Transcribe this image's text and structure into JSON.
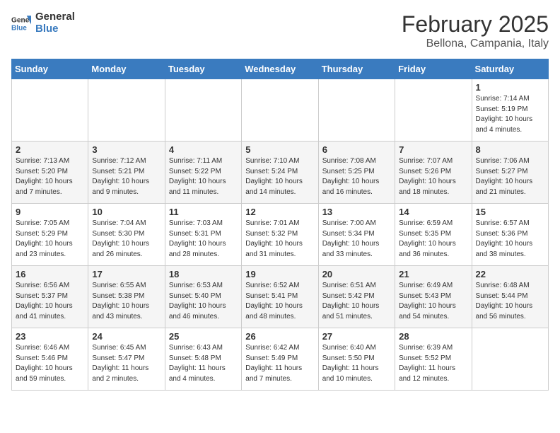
{
  "header": {
    "logo_general": "General",
    "logo_blue": "Blue",
    "month_year": "February 2025",
    "location": "Bellona, Campania, Italy"
  },
  "days_of_week": [
    "Sunday",
    "Monday",
    "Tuesday",
    "Wednesday",
    "Thursday",
    "Friday",
    "Saturday"
  ],
  "weeks": [
    [
      {
        "day": "",
        "info": ""
      },
      {
        "day": "",
        "info": ""
      },
      {
        "day": "",
        "info": ""
      },
      {
        "day": "",
        "info": ""
      },
      {
        "day": "",
        "info": ""
      },
      {
        "day": "",
        "info": ""
      },
      {
        "day": "1",
        "info": "Sunrise: 7:14 AM\nSunset: 5:19 PM\nDaylight: 10 hours\nand 4 minutes."
      }
    ],
    [
      {
        "day": "2",
        "info": "Sunrise: 7:13 AM\nSunset: 5:20 PM\nDaylight: 10 hours\nand 7 minutes."
      },
      {
        "day": "3",
        "info": "Sunrise: 7:12 AM\nSunset: 5:21 PM\nDaylight: 10 hours\nand 9 minutes."
      },
      {
        "day": "4",
        "info": "Sunrise: 7:11 AM\nSunset: 5:22 PM\nDaylight: 10 hours\nand 11 minutes."
      },
      {
        "day": "5",
        "info": "Sunrise: 7:10 AM\nSunset: 5:24 PM\nDaylight: 10 hours\nand 14 minutes."
      },
      {
        "day": "6",
        "info": "Sunrise: 7:08 AM\nSunset: 5:25 PM\nDaylight: 10 hours\nand 16 minutes."
      },
      {
        "day": "7",
        "info": "Sunrise: 7:07 AM\nSunset: 5:26 PM\nDaylight: 10 hours\nand 18 minutes."
      },
      {
        "day": "8",
        "info": "Sunrise: 7:06 AM\nSunset: 5:27 PM\nDaylight: 10 hours\nand 21 minutes."
      }
    ],
    [
      {
        "day": "9",
        "info": "Sunrise: 7:05 AM\nSunset: 5:29 PM\nDaylight: 10 hours\nand 23 minutes."
      },
      {
        "day": "10",
        "info": "Sunrise: 7:04 AM\nSunset: 5:30 PM\nDaylight: 10 hours\nand 26 minutes."
      },
      {
        "day": "11",
        "info": "Sunrise: 7:03 AM\nSunset: 5:31 PM\nDaylight: 10 hours\nand 28 minutes."
      },
      {
        "day": "12",
        "info": "Sunrise: 7:01 AM\nSunset: 5:32 PM\nDaylight: 10 hours\nand 31 minutes."
      },
      {
        "day": "13",
        "info": "Sunrise: 7:00 AM\nSunset: 5:34 PM\nDaylight: 10 hours\nand 33 minutes."
      },
      {
        "day": "14",
        "info": "Sunrise: 6:59 AM\nSunset: 5:35 PM\nDaylight: 10 hours\nand 36 minutes."
      },
      {
        "day": "15",
        "info": "Sunrise: 6:57 AM\nSunset: 5:36 PM\nDaylight: 10 hours\nand 38 minutes."
      }
    ],
    [
      {
        "day": "16",
        "info": "Sunrise: 6:56 AM\nSunset: 5:37 PM\nDaylight: 10 hours\nand 41 minutes."
      },
      {
        "day": "17",
        "info": "Sunrise: 6:55 AM\nSunset: 5:38 PM\nDaylight: 10 hours\nand 43 minutes."
      },
      {
        "day": "18",
        "info": "Sunrise: 6:53 AM\nSunset: 5:40 PM\nDaylight: 10 hours\nand 46 minutes."
      },
      {
        "day": "19",
        "info": "Sunrise: 6:52 AM\nSunset: 5:41 PM\nDaylight: 10 hours\nand 48 minutes."
      },
      {
        "day": "20",
        "info": "Sunrise: 6:51 AM\nSunset: 5:42 PM\nDaylight: 10 hours\nand 51 minutes."
      },
      {
        "day": "21",
        "info": "Sunrise: 6:49 AM\nSunset: 5:43 PM\nDaylight: 10 hours\nand 54 minutes."
      },
      {
        "day": "22",
        "info": "Sunrise: 6:48 AM\nSunset: 5:44 PM\nDaylight: 10 hours\nand 56 minutes."
      }
    ],
    [
      {
        "day": "23",
        "info": "Sunrise: 6:46 AM\nSunset: 5:46 PM\nDaylight: 10 hours\nand 59 minutes."
      },
      {
        "day": "24",
        "info": "Sunrise: 6:45 AM\nSunset: 5:47 PM\nDaylight: 11 hours\nand 2 minutes."
      },
      {
        "day": "25",
        "info": "Sunrise: 6:43 AM\nSunset: 5:48 PM\nDaylight: 11 hours\nand 4 minutes."
      },
      {
        "day": "26",
        "info": "Sunrise: 6:42 AM\nSunset: 5:49 PM\nDaylight: 11 hours\nand 7 minutes."
      },
      {
        "day": "27",
        "info": "Sunrise: 6:40 AM\nSunset: 5:50 PM\nDaylight: 11 hours\nand 10 minutes."
      },
      {
        "day": "28",
        "info": "Sunrise: 6:39 AM\nSunset: 5:52 PM\nDaylight: 11 hours\nand 12 minutes."
      },
      {
        "day": "",
        "info": ""
      }
    ]
  ]
}
